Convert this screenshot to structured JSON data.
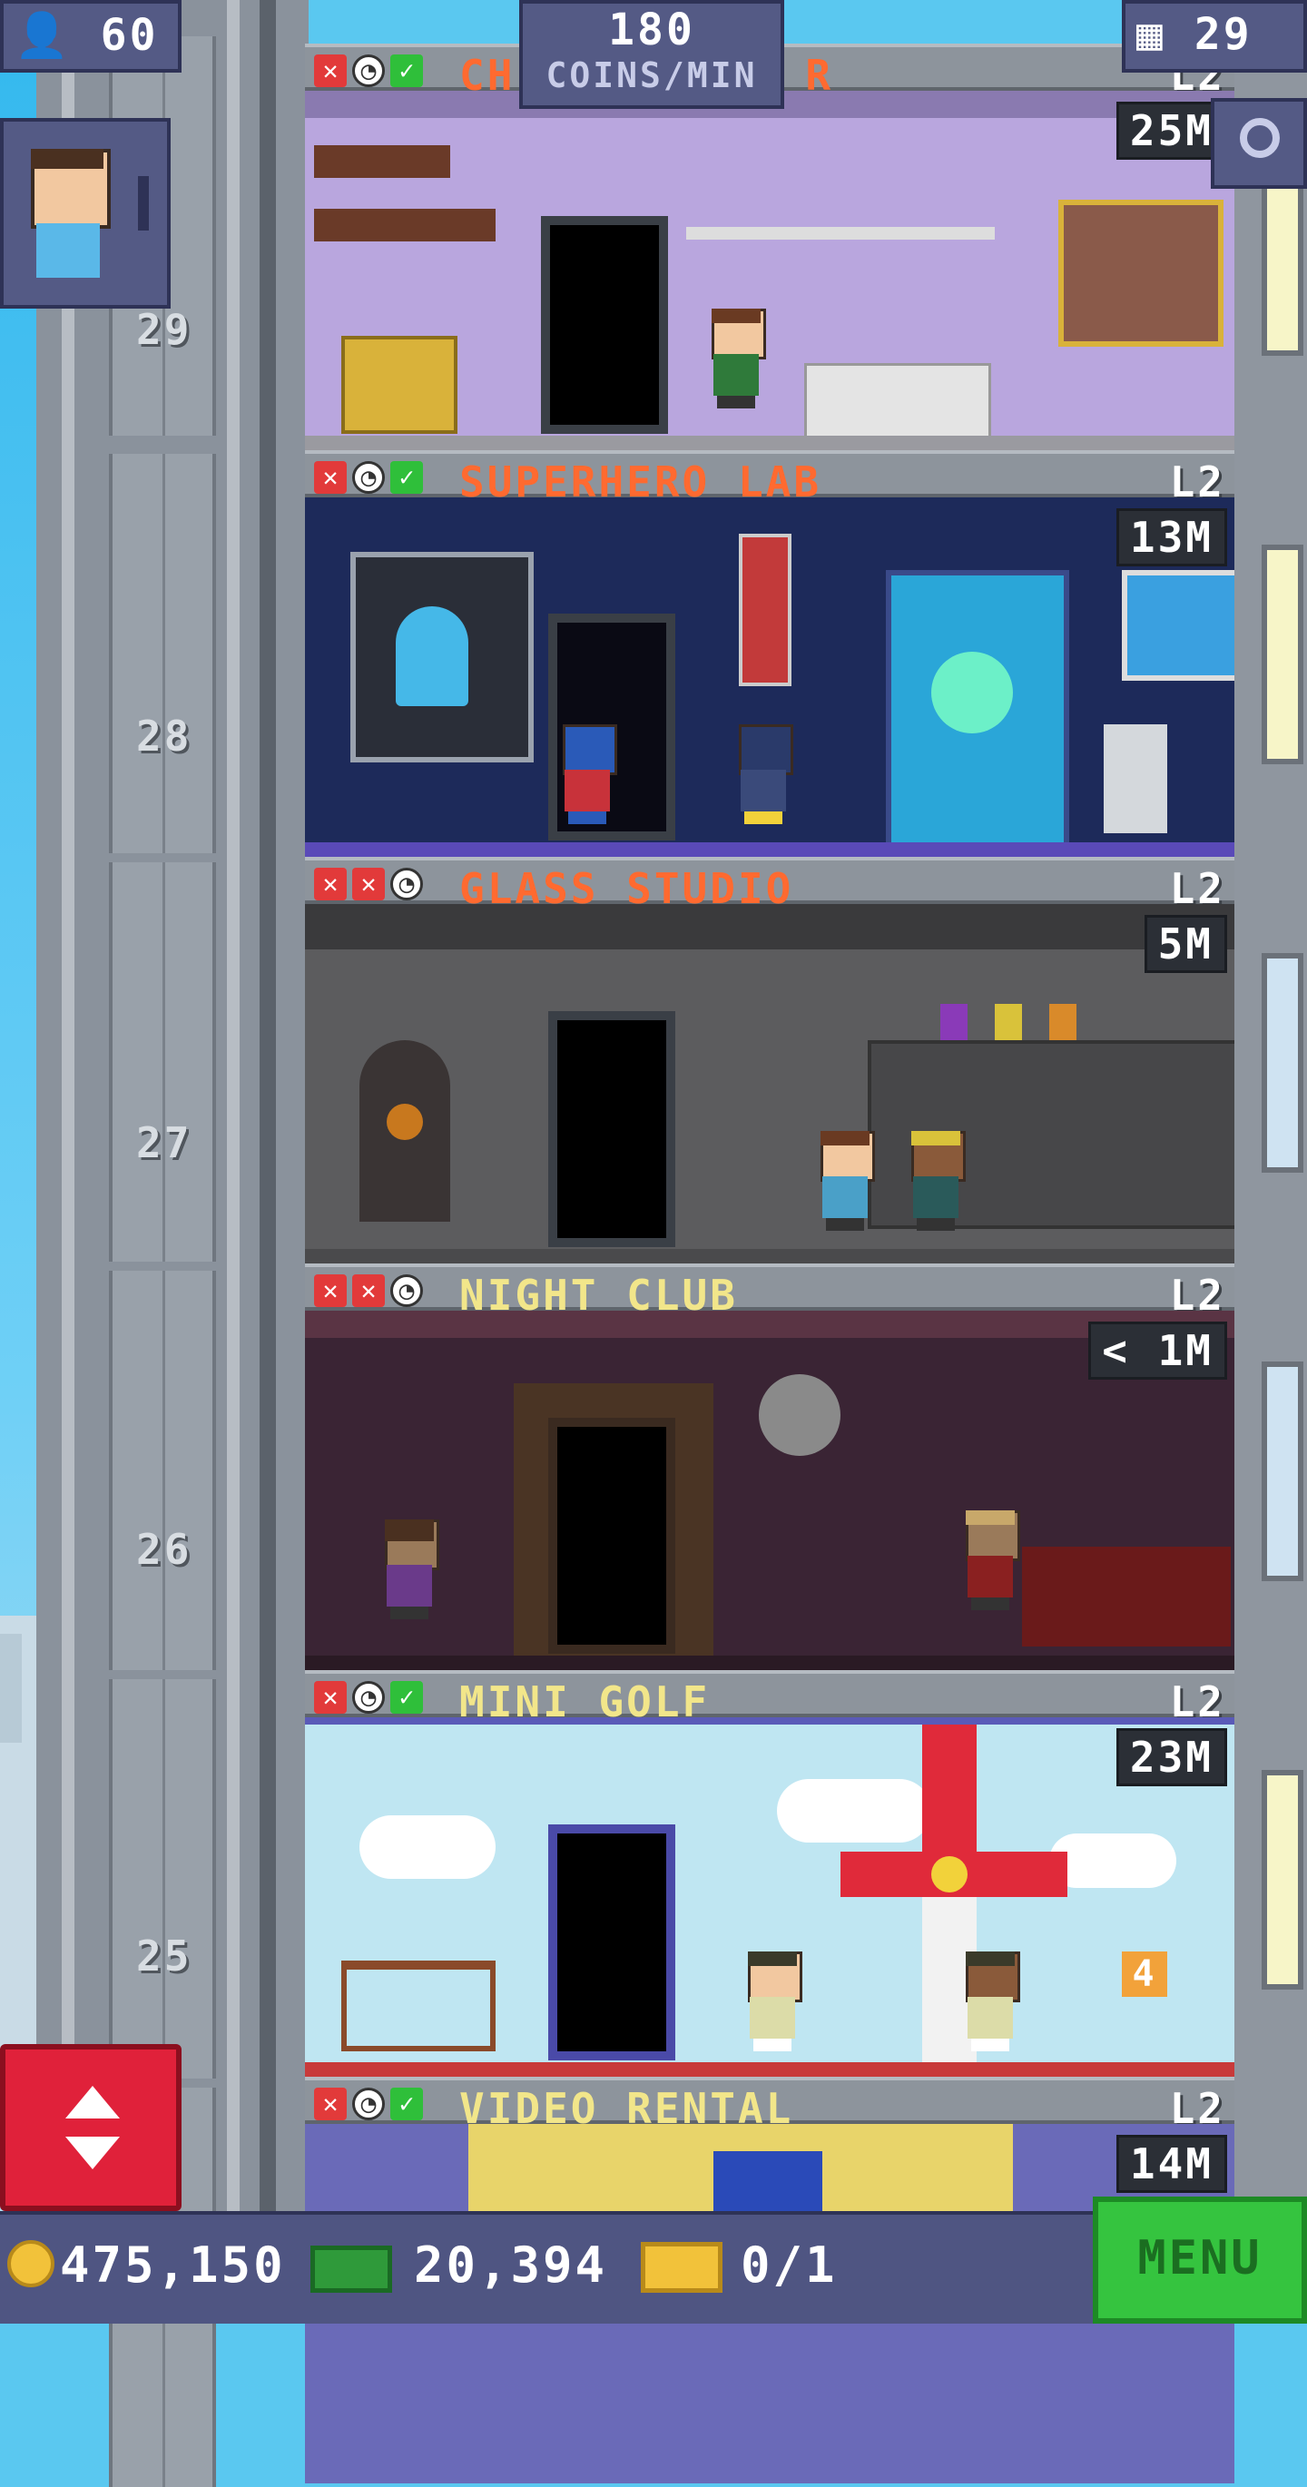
{
  "hud": {
    "population": "60",
    "coins_per_min_value": "180",
    "coins_per_min_label": "COINS/MIN",
    "floors": "29",
    "person_icon": "person-icon",
    "floors_icon": "building-icon",
    "magnify_icon": "magnify-icon"
  },
  "shaft": {
    "floor_numbers": [
      "29",
      "28",
      "27",
      "26",
      "25"
    ]
  },
  "rooms": [
    {
      "name": "CH",
      "name_suffix": "R",
      "level": "L2",
      "timer": "25M",
      "status": [
        "x",
        "clock",
        "check"
      ],
      "name_color": "#ff6a30",
      "bg": "#b9a6de"
    },
    {
      "name": "SUPERHERO LAB",
      "level": "L2",
      "timer": "13M",
      "status": [
        "x",
        "clock",
        "check"
      ],
      "name_color": "#ff6a30",
      "bg": "#1d2a5a"
    },
    {
      "name": "GLASS STUDIO",
      "level": "L2",
      "timer": "5M",
      "status": [
        "x",
        "x",
        "clock"
      ],
      "name_color": "#ff6a30",
      "bg": "#5a5a5a"
    },
    {
      "name": "NIGHT CLUB",
      "level": "L2",
      "timer": "< 1M",
      "status": [
        "x",
        "x",
        "clock"
      ],
      "name_color": "#f2e68a",
      "bg": "#3a2434"
    },
    {
      "name": "MINI GOLF",
      "level": "L2",
      "timer": "23M",
      "status": [
        "x",
        "clock",
        "check"
      ],
      "name_color": "#f2e68a",
      "bg": "#bfe6f2"
    },
    {
      "name": "VIDEO RENTAL",
      "level": "L2",
      "timer": "14M",
      "status": [
        "x",
        "clock",
        "check"
      ],
      "name_color": "#f2e68a",
      "bg": "#e8d46a"
    }
  ],
  "golf_hole_number": "4",
  "bottom": {
    "coins": "475,150",
    "bux": "20,394",
    "tickets": "0/1",
    "menu_label": "MENU",
    "coin_icon": "coin-icon",
    "bux_icon": "bux-icon",
    "ticket_icon": "ticket-icon"
  },
  "elevator_button_icon": "up-down-arrows-icon"
}
